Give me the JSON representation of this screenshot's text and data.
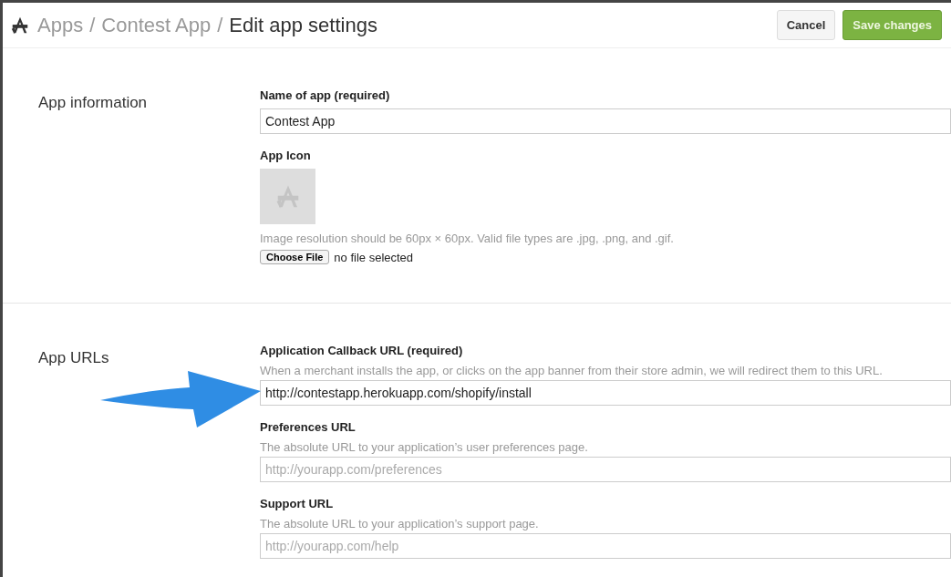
{
  "header": {
    "crumbs": [
      {
        "label": "Apps",
        "current": false
      },
      {
        "label": "Contest App",
        "current": false
      },
      {
        "label": "Edit app settings",
        "current": true
      }
    ],
    "separator": "/",
    "buttons": [
      {
        "label": "Cancel",
        "kind": "secondary"
      },
      {
        "label": "Save changes",
        "kind": "primary"
      }
    ]
  },
  "sections": [
    {
      "title": "App information",
      "fields": [
        {
          "kind": "text",
          "label": "Name of app (required)",
          "value": "Contest App"
        },
        {
          "kind": "image",
          "label": "App Icon",
          "help": "Image resolution should be 60px × 60px. Valid file types are .jpg, .png, and .gif.",
          "button": "Choose File",
          "status": "no file selected"
        }
      ]
    },
    {
      "title": "App URLs",
      "fields": [
        {
          "kind": "text",
          "label": "Application Callback URL (required)",
          "help": "When a merchant installs the app, or clicks on the app banner from their store admin, we will redirect them to this URL.",
          "value": "http://contestapp.herokuapp.com/shopify/install",
          "annotated": true
        },
        {
          "kind": "text",
          "label": "Preferences URL",
          "help": "The absolute URL to your application’s user preferences page.",
          "placeholder": "http://yourapp.com/preferences"
        },
        {
          "kind": "text",
          "label": "Support URL",
          "help": "The absolute URL to your application’s support page.",
          "placeholder": "http://yourapp.com/help"
        }
      ]
    }
  ]
}
